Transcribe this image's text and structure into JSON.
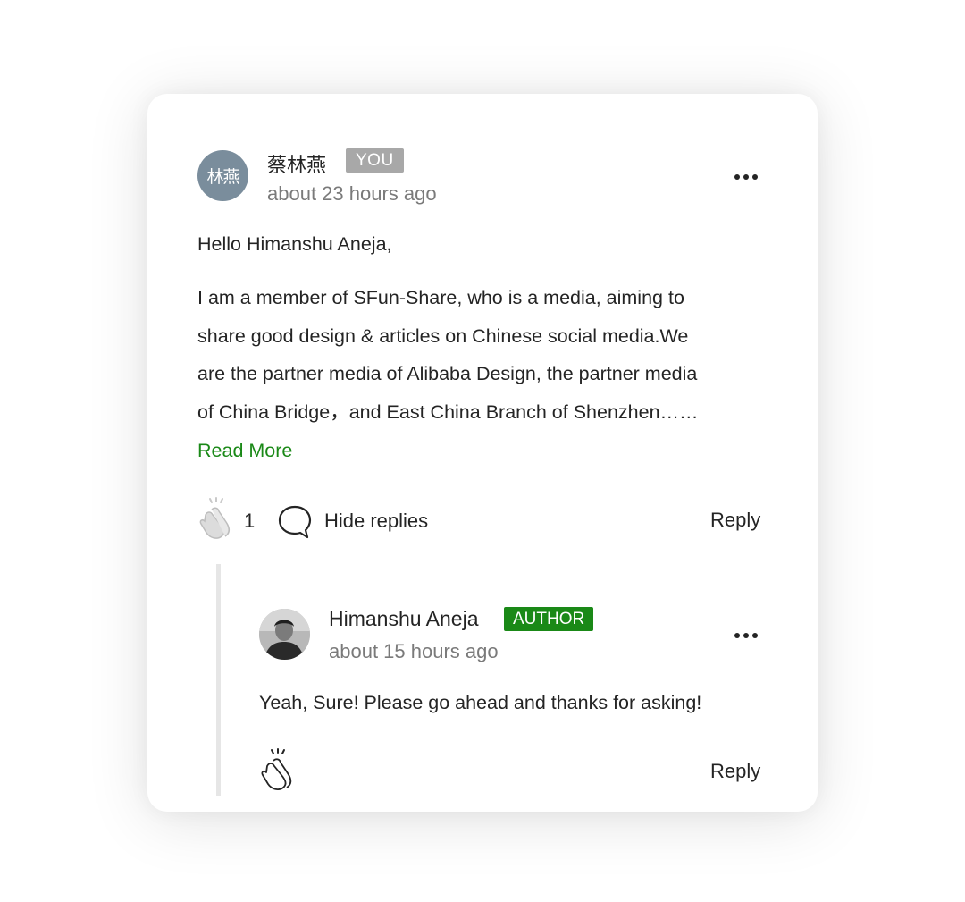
{
  "comment": {
    "avatar_initials": "林燕",
    "author_name": "蔡林燕",
    "badge": "YOU",
    "timestamp": "about 23 hours ago",
    "greeting": "Hello Himanshu Aneja,",
    "body_lines": [
      "I am a member of SFun-Share, who is a media, aiming to",
      "share good design & articles on Chinese social media.We",
      "are the partner media of Alibaba Design, the partner media",
      "of China Bridge，and East China Branch of Shenzhen……"
    ],
    "read_more_label": "Read More",
    "clap_count": "1",
    "hide_replies_label": "Hide replies",
    "reply_label": "Reply"
  },
  "reply": {
    "author_name": "Himanshu Aneja",
    "badge": "AUTHOR",
    "timestamp": "about 15 hours ago",
    "body": "Yeah, Sure! Please go ahead and thanks for asking!",
    "reply_label": "Reply"
  },
  "colors": {
    "text": "#242424",
    "muted": "#7a7a7a",
    "accent_green": "#1a8917",
    "you_badge": "#a8a8a8",
    "avatar_bg": "#7a8d9c",
    "thread_line": "#e6e6e6"
  },
  "icons": {
    "clap": "clap-icon",
    "comment": "comment-bubble-icon",
    "more": "more-dots-icon"
  }
}
